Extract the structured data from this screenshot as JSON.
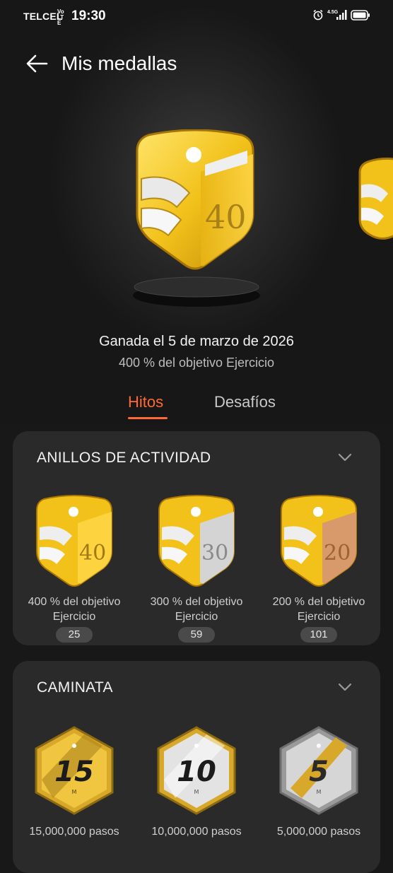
{
  "status_bar": {
    "carrier": "TELCEL",
    "volte": "Vo LTE",
    "time": "19:30",
    "network": "4.5G"
  },
  "header": {
    "title": "Mis medallas"
  },
  "featured": {
    "earned_text": "Ganada el 5 de marzo de 2026",
    "goal_text": "400 % del objetivo Ejercicio",
    "medal_number": "40"
  },
  "tabs": [
    {
      "label": "Hitos",
      "active": true
    },
    {
      "label": "Desafíos",
      "active": false
    }
  ],
  "sections": {
    "activity_rings": {
      "title": "ANILLOS DE ACTIVIDAD",
      "items": [
        {
          "label_line1": "400 % del objetivo",
          "label_line2": "Ejercicio",
          "count": "25",
          "medal_number": "40"
        },
        {
          "label_line1": "300 % del objetivo",
          "label_line2": "Ejercicio",
          "count": "59",
          "medal_number": "30"
        },
        {
          "label_line1": "200 % del objetivo",
          "label_line2": "Ejercicio",
          "count": "101",
          "medal_number": "20"
        }
      ]
    },
    "walking": {
      "title": "CAMINATA",
      "items": [
        {
          "label": "15,000,000 pasos",
          "medal_number": "15",
          "medal_unit": "M"
        },
        {
          "label": "10,000,000 pasos",
          "medal_number": "10",
          "medal_unit": "M"
        },
        {
          "label": "5,000,000 pasos",
          "medal_number": "5",
          "medal_unit": "M"
        }
      ]
    }
  },
  "colors": {
    "accent": "#ff6a33",
    "gold": "#f2c21b",
    "silver": "#c9c9c9",
    "bronze": "#d89a6a",
    "card_bg": "#2a2a2a"
  }
}
